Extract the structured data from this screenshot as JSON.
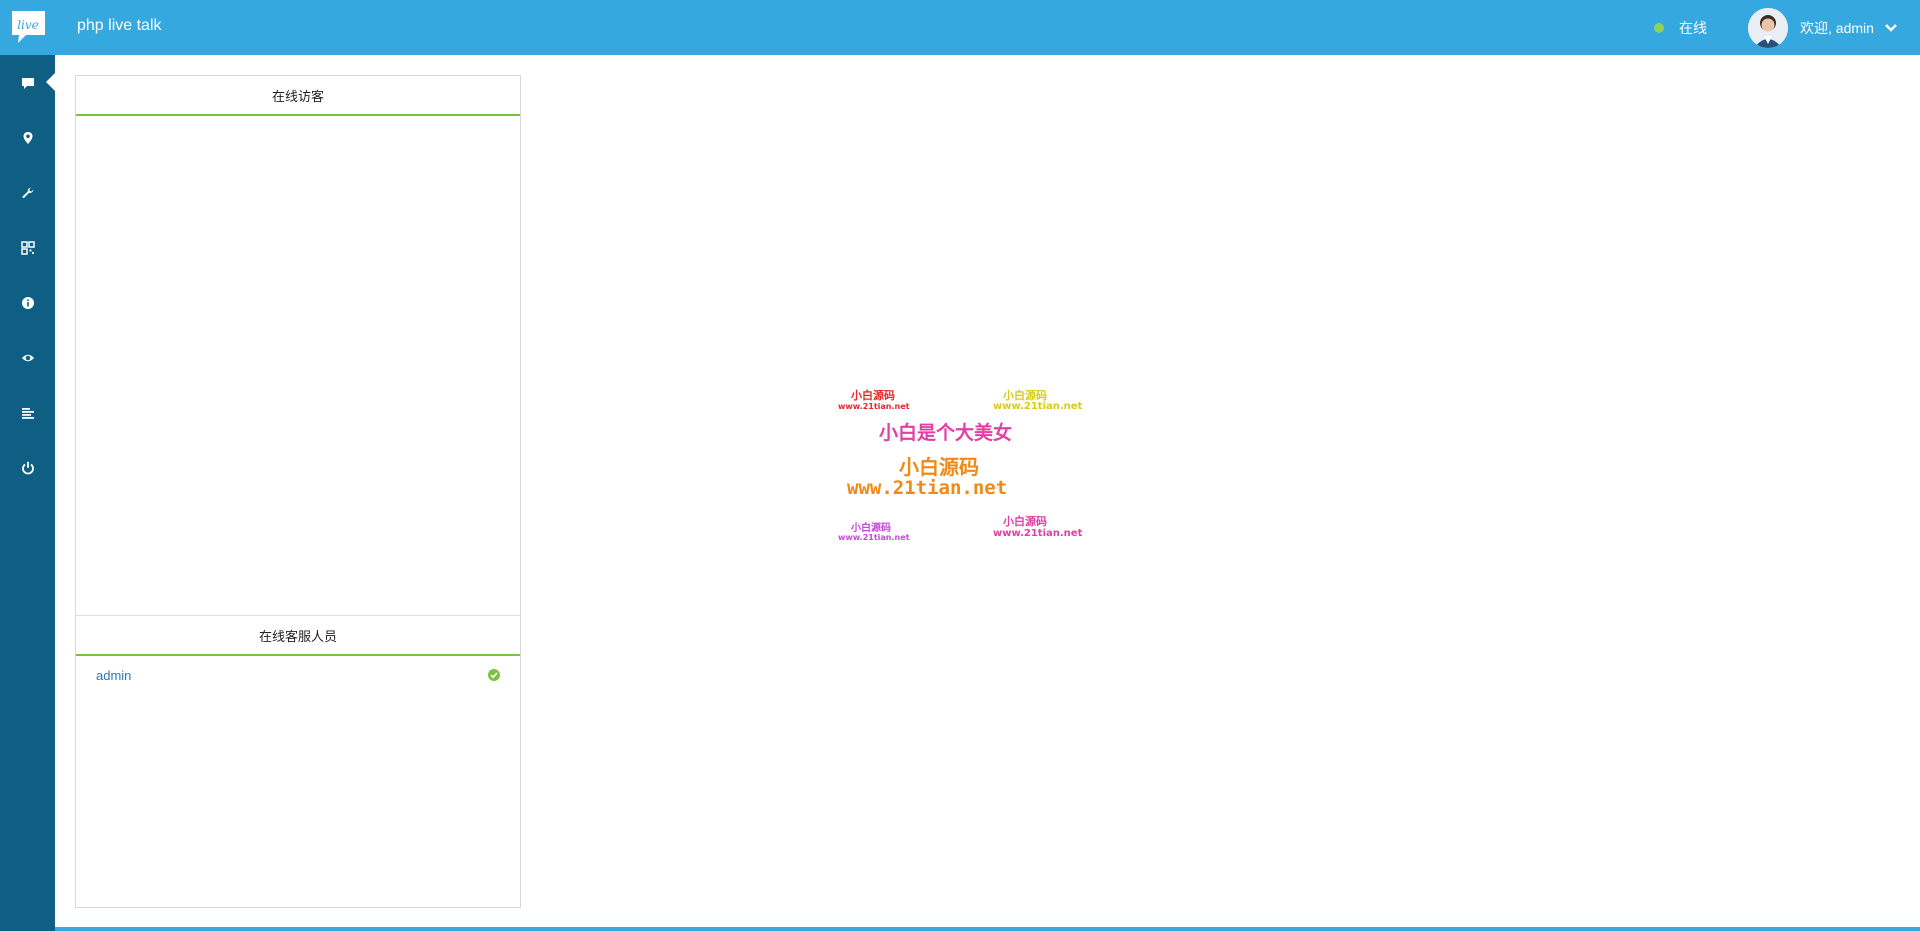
{
  "app": {
    "title": "php live talk"
  },
  "header": {
    "status_label": "在线",
    "welcome_text": "欢迎, admin",
    "colors": {
      "bar": "#35a8e0",
      "status_dot": "#8fd25a"
    }
  },
  "sidebar": {
    "items": [
      {
        "name": "chat",
        "icon": "chat-icon",
        "active": true
      },
      {
        "name": "location",
        "icon": "map-marker-icon"
      },
      {
        "name": "settings",
        "icon": "wrench-icon"
      },
      {
        "name": "qrcode",
        "icon": "qrcode-icon"
      },
      {
        "name": "info",
        "icon": "info-icon"
      },
      {
        "name": "monitor",
        "icon": "eye-icon"
      },
      {
        "name": "history",
        "icon": "list-icon"
      },
      {
        "name": "logout",
        "icon": "power-icon"
      }
    ]
  },
  "visitors_panel": {
    "title": "在线访客"
  },
  "staff_panel": {
    "title": "在线客服人员",
    "staff": [
      {
        "name": "admin",
        "status": "online"
      }
    ]
  },
  "watermark": {
    "lines": [
      "小白源码",
      "www.21tian.net",
      "小白源码",
      "www.21tian.net",
      "小白是个大美女",
      "小白源码",
      "www.21tian.net",
      "小白源码",
      "www.21tian.net",
      "小白源码",
      "www.21tian.net"
    ]
  }
}
